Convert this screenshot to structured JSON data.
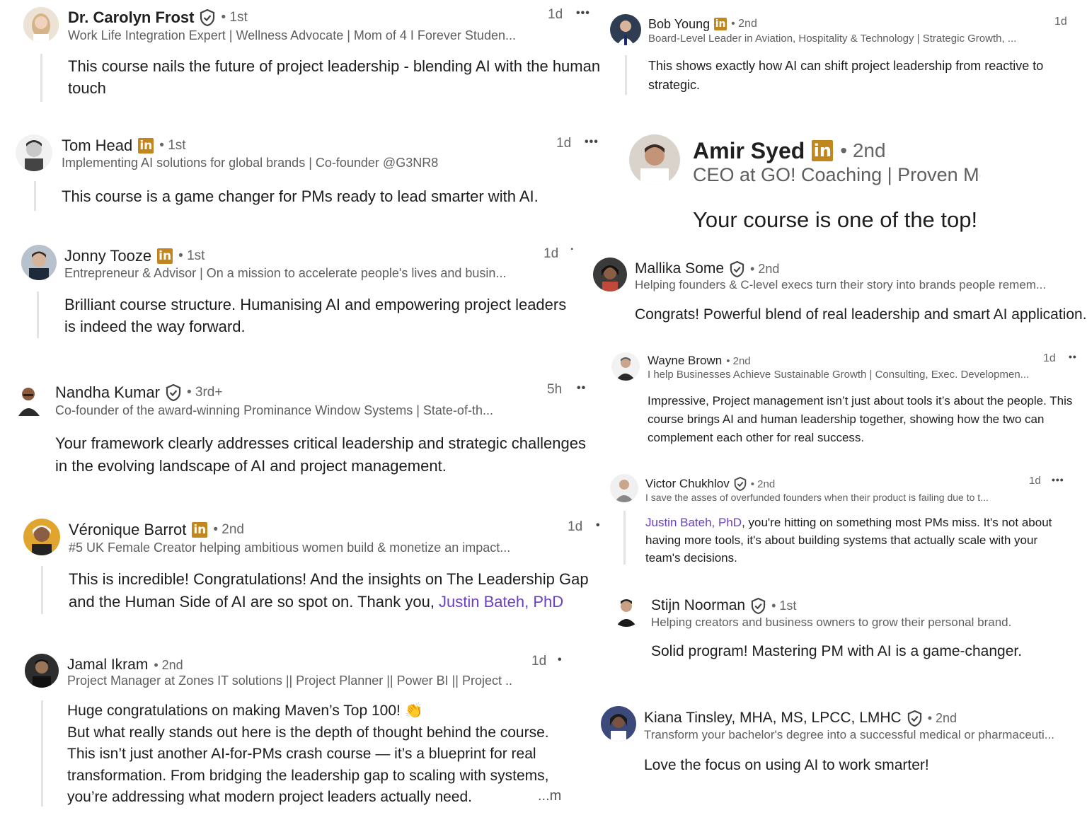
{
  "comments": [
    {
      "name": "Dr. Carolyn Frost",
      "degree": "• 1st",
      "headline": "Work Life Integration Expert | Wellness Advocate | Mom of 4 I Forever Studen...",
      "time": "1d",
      "more": "•••",
      "body": "This course nails the future of project leadership - blending AI with the human touch",
      "avatar_bg": "#d9c7b2"
    },
    {
      "name": "Tom Head",
      "degree": "• 1st",
      "headline": "Implementing AI solutions for global brands | Co-founder @G3NR8",
      "time": "1d",
      "more": "•••",
      "body": "This course is a game changer for PMs ready to lead smarter with AI.",
      "avatar_bg": "#cfcfcf"
    },
    {
      "name": "Jonny Tooze",
      "degree": "• 1st",
      "headline": "Entrepreneur & Advisor | On a mission to accelerate people's lives and busin...",
      "time": "1d",
      "more": "·",
      "body": "Brilliant course structure. Humanising AI and empowering project leaders is indeed the way forward.",
      "avatar_bg": "#9aa7b4"
    },
    {
      "name": "Nandha Kumar",
      "degree": "• 3rd+",
      "headline": "Co-founder of the award-winning Prominance Window Systems | State-of-th...",
      "time": "5h",
      "more": "••",
      "body": "Your framework clearly addresses critical leadership and strategic challenges in the evolving landscape of AI and project management.",
      "avatar_bg": "#e5e5e5"
    },
    {
      "name": "Véronique Barrot",
      "degree": "• 2nd",
      "headline": "#5 UK Female Creator helping ambitious women build & monetize an impact...",
      "time": "1d",
      "more": "•",
      "body_pre": "This is incredible! Congratulations! And the insights on The Leadership Gap and the Human Side of AI are so spot on. Thank you, ",
      "body_link": "Justin Bateh, PhD",
      "avatar_bg": "#e0a52e"
    },
    {
      "name": "Jamal Ikram",
      "degree": "• 2nd",
      "headline": "Project Manager at Zones IT solutions || Project Planner || Power BI || Project ...",
      "time": "1d",
      "more": "•",
      "body_lines": [
        "Huge congratulations on making Maven’s Top 100! 👏",
        "But what really stands out here is the depth of thought behind the course.",
        "This isn’t just another AI-for-PMs crash course — it’s a blueprint for real",
        "transformation. From bridging the leadership gap to scaling with systems,",
        "you’re addressing what modern project leaders actually need."
      ],
      "see_more": "...m",
      "avatar_bg": "#3a3a3a"
    },
    {
      "name": "Bob Young",
      "degree": "• 2nd",
      "headline": "Board-Level Leader in Aviation, Hospitality & Technology | Strategic Growth, ...",
      "time": "1d",
      "body": "This shows exactly how AI can shift project leadership from reactive to strategic.",
      "avatar_bg": "#2e3d52"
    },
    {
      "name": "Amir Syed",
      "degree": "• 2nd",
      "headline": "CEO at GO! Coaching | Proven Met",
      "body": "Your course is one of the top!",
      "avatar_bg": "#cfc8bf"
    },
    {
      "name": "Mallika Some",
      "degree": "• 2nd",
      "headline": "Helping founders & C-level execs turn their story into brands people remem...",
      "body": "Congrats! Powerful blend of real leadership and smart AI application.",
      "avatar_bg": "#2a2a2a"
    },
    {
      "name": "Wayne Brown",
      "degree": "• 2nd",
      "headline": "I help Businesses Achieve Sustainable Growth | Consulting, Exec. Developmen...",
      "time": "1d",
      "more": "••",
      "body": "Impressive, Project management isn’t just about tools it’s about the people. This course brings AI and human leadership together, showing how the two can complement each other for real success.",
      "avatar_bg": "#e9e9e9"
    },
    {
      "name": "Victor Chukhlov",
      "degree": "• 2nd",
      "headline": "I save the asses of overfunded founders when their product is failing due to t...",
      "time": "1d",
      "more": "•••",
      "body_link": "Justin Bateh, PhD",
      "body_post": ", you're hitting on something most PMs miss. It's not about having more tools, it's about building systems that actually scale with your team's decisions.",
      "avatar_bg": "#ececec"
    },
    {
      "name": "Stijn Noorman",
      "degree": "• 1st",
      "headline": "Helping creators and business owners to grow their personal brand.",
      "body": "Solid program! Mastering PM with AI is a game-changer.",
      "avatar_bg": "#ffffff"
    },
    {
      "name": "Kiana Tinsley, MHA, MS, LPCC, LMHC",
      "degree": "• 2nd",
      "headline": "Transform your bachelor's degree into a successful medical or pharmaceuti...",
      "body": "Love the focus on using AI to work smarter!",
      "avatar_bg": "#3b4a7a"
    }
  ],
  "badge": {
    "linkedin_text": "in",
    "linkedin_color": "#c1861e",
    "verified": "verified-shield-icon"
  }
}
